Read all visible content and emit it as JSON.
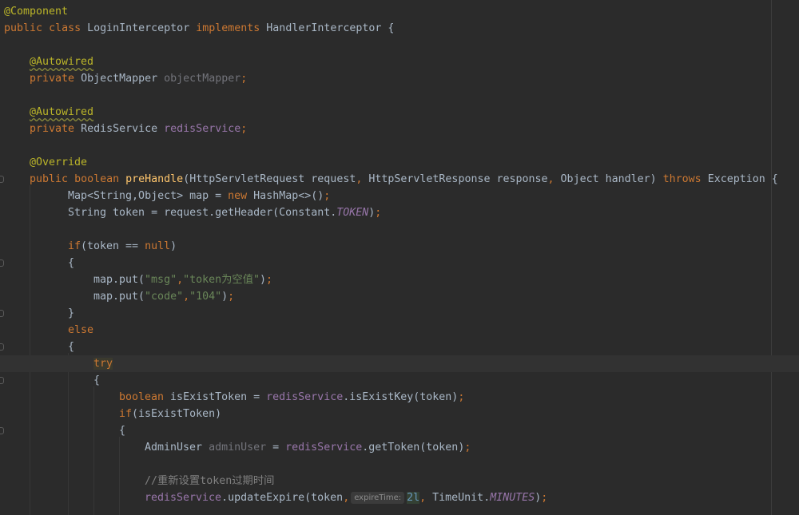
{
  "code": {
    "ann_component": "@Component",
    "kw_public": "public",
    "kw_class": "class",
    "class_name": "LoginInterceptor",
    "kw_implements": "implements",
    "iface_name": "HandlerInterceptor {",
    "ann_autowired": "@Autowired",
    "kw_private": "private",
    "type_object_mapper": "ObjectMapper",
    "field_object_mapper": "objectMapper",
    "semi": ";",
    "type_redis_service": "RedisService",
    "field_redis_service": "redisService",
    "ann_override": "@Override",
    "kw_boolean": "boolean",
    "method_name": "preHandle",
    "params_1": "(HttpServletRequest request",
    "comma": ",",
    "params_2": " HttpServletResponse response",
    "params_3": " Object handler) ",
    "kw_throws": "throws",
    "throws_rest": " Exception {",
    "map_decl": "Map<String,Object> map = ",
    "kw_new": "new",
    "map_new": " HashMap<>()",
    "token_decl": "String token = request.getHeader(Constant.",
    "const_token": "TOKEN",
    "close_paren_semi": ");",
    "kw_if": "if",
    "if_cond_1": "(token == ",
    "kw_null": "null",
    "close_paren": ")",
    "brace_open": "{",
    "brace_close": "}",
    "map_put": "map.put(",
    "str_msg": "\"msg\"",
    "str_msg_val": "\"token为空值\"",
    "str_code": "\"code\"",
    "str_code_val": "\"104\"",
    "kw_else": "else",
    "kw_try": "try",
    "is_exist_decl": " isExistToken = ",
    "field_redis": "redisService",
    "is_exist_call": ".isExistKey(token)",
    "if_exist_cond": "(isExistToken)",
    "admin_type": "AdminUser ",
    "admin_var": "adminUser",
    "admin_assign": " = ",
    "get_token_call": ".getToken(token)",
    "comment": "//重新设置token过期时间",
    "update_call": ".updateExpire(token",
    "hint_label": "expireTime:",
    "num_val": "2l",
    "timeunit": " TimeUnit.",
    "const_minutes": "MINUTES"
  }
}
